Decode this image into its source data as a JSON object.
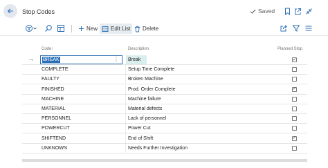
{
  "header": {
    "title": "Stop Codes",
    "saved_label": "Saved"
  },
  "actions": {
    "new_label": "New",
    "edit_list_label": "Edit List",
    "delete_label": "Delete"
  },
  "table": {
    "columns": {
      "code": "Code",
      "sort_indicator": "↑",
      "description": "Description",
      "planned_stop": "Planned Stop"
    },
    "rows": [
      {
        "code": "BREAK",
        "description": "Break",
        "planned_stop": true
      },
      {
        "code": "COMPLETE",
        "description": "Setup Time Complete",
        "planned_stop": false
      },
      {
        "code": "FAULTY",
        "description": "Broken Machine",
        "planned_stop": false
      },
      {
        "code": "FINISHED",
        "description": "Prod. Order Complete",
        "planned_stop": true
      },
      {
        "code": "MACHINE",
        "description": "Machine failure",
        "planned_stop": false
      },
      {
        "code": "MATERIAL",
        "description": "Material defects",
        "planned_stop": false
      },
      {
        "code": "PERSONNEL",
        "description": "Lack of personnel",
        "planned_stop": false
      },
      {
        "code": "POWERCUT",
        "description": "Power Cut",
        "planned_stop": false
      },
      {
        "code": "SHIFTEND",
        "description": "End of Shift",
        "planned_stop": true
      },
      {
        "code": "UNKNOWN",
        "description": "Needs Further Investigation",
        "planned_stop": false
      }
    ]
  },
  "colors": {
    "accent": "#2b6fb6",
    "selection_bg": "#dbeeee"
  }
}
